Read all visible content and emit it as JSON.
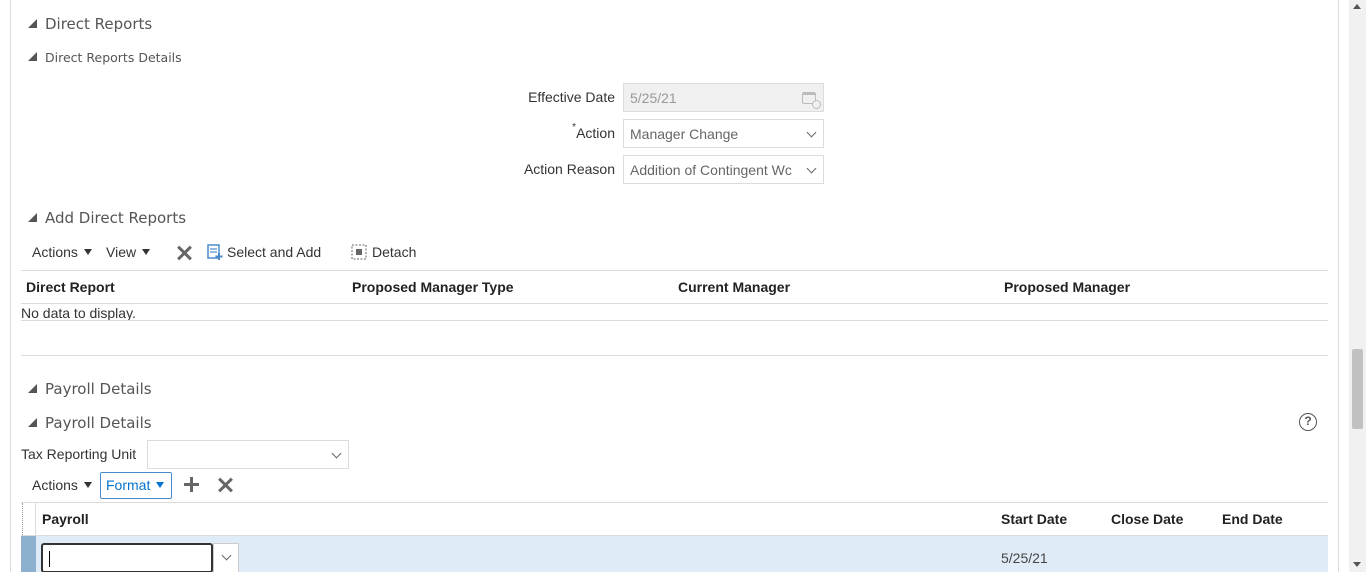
{
  "direct_reports": {
    "section_title": "Direct Reports",
    "details_title": "Direct Reports Details",
    "effective_date_label": "Effective Date",
    "effective_date_value": "5/25/21",
    "action_required_marker": "*",
    "action_label": "Action",
    "action_value": "Manager Change",
    "action_reason_label": "Action Reason",
    "action_reason_value": "Addition of Contingent Wc"
  },
  "add_direct_reports": {
    "title": "Add Direct Reports",
    "toolbar": {
      "actions_label": "Actions",
      "view_label": "View",
      "select_and_add_label": "Select and Add",
      "detach_label": "Detach"
    },
    "columns": [
      "Direct Report",
      "Proposed Manager Type",
      "Current Manager",
      "Proposed Manager"
    ],
    "empty_message": "No data to display."
  },
  "payroll": {
    "section_title": "Payroll Details",
    "sub_title": "Payroll Details",
    "help_glyph": "?",
    "tax_reporting_unit_label": "Tax Reporting Unit",
    "tax_reporting_unit_value": "",
    "toolbar": {
      "actions_label": "Actions",
      "format_label": "Format"
    },
    "columns": {
      "payroll": "Payroll",
      "start_date": "Start Date",
      "close_date": "Close Date",
      "end_date": "End Date"
    },
    "rows": [
      {
        "payroll": "",
        "start_date": "5/25/21",
        "close_date": "",
        "end_date": ""
      }
    ]
  },
  "colors": {
    "selected_row": "#dfebf7",
    "focus_border": "#333333",
    "link_blue": "#0572ce",
    "icon_blue": "#4a8cca"
  }
}
